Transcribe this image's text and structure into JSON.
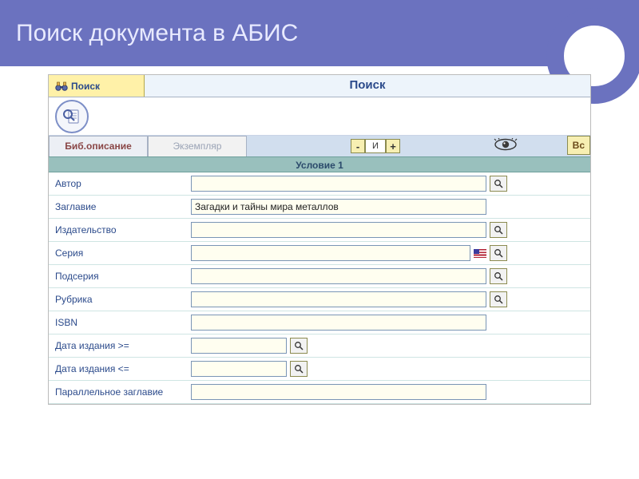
{
  "slide": {
    "title": "Поиск документа в АБИС"
  },
  "topbar": {
    "tab_label": "Поиск",
    "page_title": "Поиск"
  },
  "tabs": {
    "active": "Биб.описание",
    "inactive": "Экземпляр"
  },
  "operator": {
    "minus": "-",
    "value": "И",
    "plus": "+"
  },
  "right_button": "Вс",
  "condition_header": "Условие 1",
  "fields": {
    "author": {
      "label": "Автор",
      "value": "",
      "lookup": true,
      "long": true
    },
    "title": {
      "label": "Заглавие",
      "value": "Загадки и тайны мира металлов",
      "lookup": false,
      "long": true
    },
    "publisher": {
      "label": "Издательство",
      "value": "",
      "lookup": true,
      "long": true
    },
    "series": {
      "label": "Серия",
      "value": "",
      "lookup": true,
      "long": true,
      "flag": true
    },
    "subseries": {
      "label": "Подсерия",
      "value": "",
      "lookup": true,
      "long": true
    },
    "rubric": {
      "label": "Рубрика",
      "value": "",
      "lookup": true,
      "long": true
    },
    "isbn": {
      "label": "ISBN",
      "value": "",
      "lookup": false,
      "long": true
    },
    "date_ge": {
      "label": "Дата издания >=",
      "value": "",
      "lookup": true,
      "long": false
    },
    "date_le": {
      "label": "Дата издания <=",
      "value": "",
      "lookup": true,
      "long": false
    },
    "par_title": {
      "label": "Параллельное заглавие",
      "value": "",
      "lookup": false,
      "long": true
    }
  }
}
